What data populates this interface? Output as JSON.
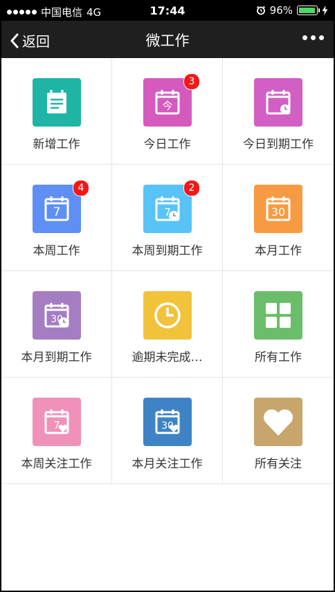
{
  "status_bar": {
    "carrier": "中国电信",
    "network": "4G",
    "time": "17:44",
    "battery": "96%",
    "battery_level": 0.96
  },
  "nav": {
    "back_label": "返回",
    "title": "微工作"
  },
  "tiles": [
    {
      "label": "新增工作",
      "color": "#1fb5a5",
      "icon": "new-work-icon"
    },
    {
      "label": "今日工作",
      "color": "#d45bbd",
      "icon": "today-calendar-icon",
      "badge": "3"
    },
    {
      "label": "今日到期工作",
      "color": "#d15fc4",
      "icon": "today-due-icon"
    },
    {
      "label": "本周工作",
      "color": "#5e8ff5",
      "icon": "week-calendar-icon",
      "badge": "4"
    },
    {
      "label": "本周到期工作",
      "color": "#58c3f6",
      "icon": "week-due-icon",
      "badge": "2"
    },
    {
      "label": "本月工作",
      "color": "#f69b41",
      "icon": "month-calendar-icon"
    },
    {
      "label": "本月到期工作",
      "color": "#a57dc3",
      "icon": "month-due-icon"
    },
    {
      "label": "逾期未完成…",
      "color": "#f1c33b",
      "icon": "clock-icon"
    },
    {
      "label": "所有工作",
      "color": "#6bbe69",
      "icon": "grid-icon"
    },
    {
      "label": "本周关注工作",
      "color": "#f091b9",
      "icon": "week-favorite-icon"
    },
    {
      "label": "本月关注工作",
      "color": "#3f83c6",
      "icon": "month-favorite-icon"
    },
    {
      "label": "所有关注",
      "color": "#c8a56b",
      "icon": "heart-icon"
    }
  ],
  "calendar_numbers": {
    "today": "今",
    "week": "7",
    "month": "30"
  }
}
